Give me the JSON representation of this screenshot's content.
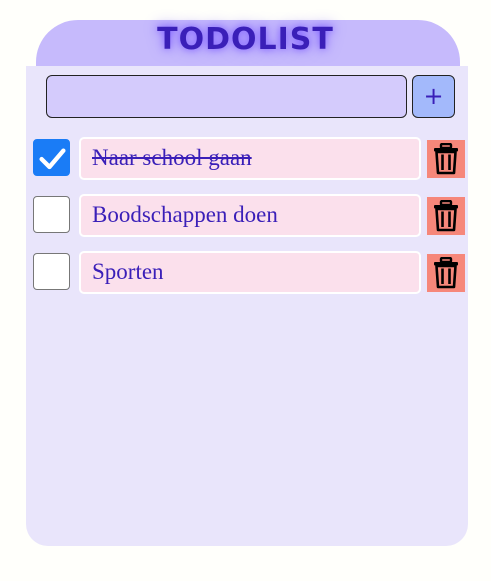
{
  "app": {
    "title": "TODOLIST"
  },
  "new_task": {
    "value": "",
    "placeholder": "",
    "add_label": "+"
  },
  "tasks": [
    {
      "label": "Naar school gaan",
      "done": true
    },
    {
      "label": "Boodschappen doen",
      "done": false
    },
    {
      "label": "Sporten",
      "done": false
    }
  ],
  "icons": {
    "checkmark": "check-icon",
    "delete": "trash-icon"
  },
  "colors": {
    "header": "#c6bafc",
    "panel": "#e9e5fb",
    "title": "#3a1fb8",
    "task_bg": "#fbe0ec",
    "delete_bg": "#f6877a",
    "checkbox_checked": "#1a7cf6",
    "add_button": "#a3b9fb"
  }
}
